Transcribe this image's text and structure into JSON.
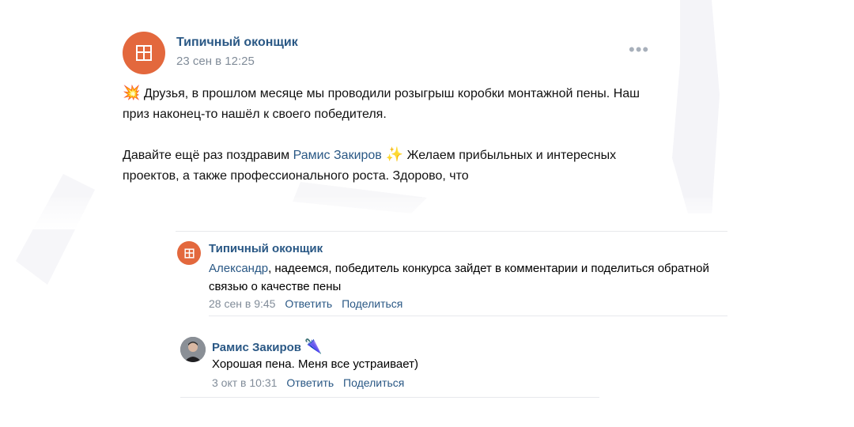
{
  "post": {
    "author": "Типичный оконщик",
    "date": "23 сен в 12:25",
    "more": "•••",
    "paragraph1_emoji": "💥",
    "paragraph1_text": " Друзья, в прошлом месяце мы проводили розыгрыш коробки монтажной пены. Наш приз наконец-то нашёл к своего победителя.",
    "paragraph2_prefix": "Давайте ещё раз поздравим ",
    "paragraph2_link": "Рамис Закиров",
    "paragraph2_emoji": " ✨",
    "paragraph2_suffix": " Желаем прибыльных и интересных проектов, а также профессионального роста. Здорово, что"
  },
  "comments": [
    {
      "author": "Типичный оконщик",
      "mention": "Александр",
      "text": ", надеемся, победитель конкурса зайдет в комментарии и поделиться обратной связью о качестве пены",
      "date": "28 сен в 9:45",
      "reply": "Ответить",
      "share": "Поделиться"
    },
    {
      "author": "Рамис Закиров",
      "author_emoji": "🥮",
      "text": "Хорошая пена. Меня все устраивает)",
      "date": "3 окт в 10:31",
      "reply": "Ответить",
      "share": "Поделиться"
    }
  ],
  "colors": {
    "link": "#2a5885",
    "meta": "#818c99",
    "avatar": "#e3683d"
  }
}
